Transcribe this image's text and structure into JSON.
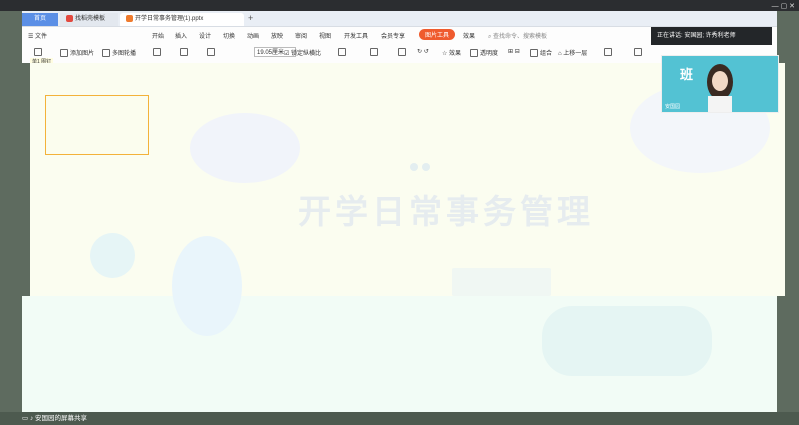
{
  "tabs": {
    "home": "首页",
    "templates": "找稻壳模板",
    "document": "开学日常事务管理(1).pptx"
  },
  "menu": {
    "file": "文件",
    "items": [
      "开始",
      "插入",
      "设计",
      "切换",
      "动画",
      "放映",
      "审阅",
      "视图",
      "开发工具",
      "会员专享"
    ],
    "picture_tools": "图片工具",
    "effects": "效果",
    "search_placeholder": "查找命令、搜索模板"
  },
  "toolbar": {
    "add_picture": "添加图片",
    "multi_outline": "多图轮播",
    "width_value": "19.05厘米",
    "lock_ratio": "锁定纵横比",
    "effect": "效果",
    "transparency": "透明度",
    "group": "组合",
    "move_up": "上移一层"
  },
  "slide": {
    "title": "开学日常事务管理",
    "video_bg_text": "班"
  },
  "left_panel": {
    "label": "单1 图钉"
  },
  "meeting": {
    "speaking": "正在讲话: 安国园; 许秀利老师",
    "participant": "安国园",
    "screen_share": "安国园的屏幕共享"
  },
  "colors": {
    "accent": "#5b8fe6",
    "picture_tools": "#ef5b2e",
    "thumb_border": "#f3b23a",
    "video_bg": "#53c2d3"
  }
}
